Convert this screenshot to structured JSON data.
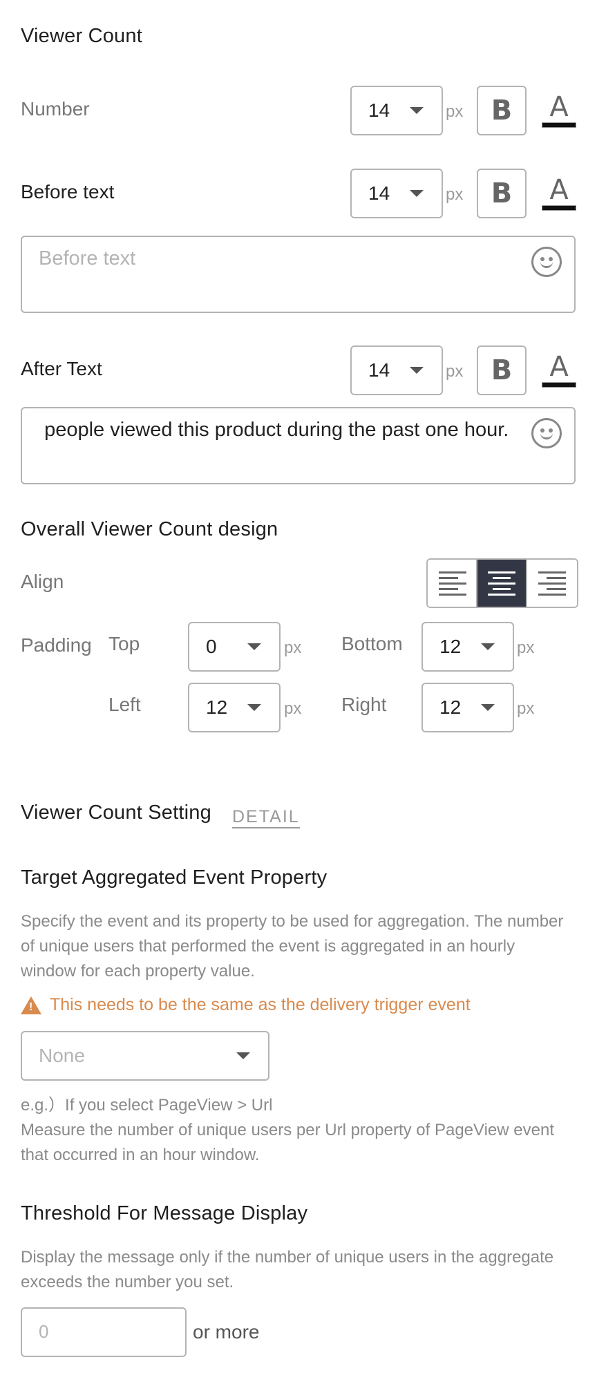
{
  "viewer_count": {
    "title": "Viewer Count",
    "number": {
      "label": "Number",
      "size": "14",
      "unit": "px",
      "bold": "B",
      "color": "A"
    },
    "before_text": {
      "label": "Before text",
      "size": "14",
      "unit": "px",
      "bold": "B",
      "color": "A",
      "placeholder": "Before text",
      "value": ""
    },
    "after_text": {
      "label": "After Text",
      "size": "14",
      "unit": "px",
      "bold": "B",
      "color": "A",
      "value": " people viewed this product during the past one hour."
    }
  },
  "overall_design": {
    "title": "Overall Viewer Count design",
    "align_label": "Align",
    "align_options": [
      "left",
      "center",
      "right"
    ],
    "align_selected": "center",
    "padding_label": "Padding",
    "padding": {
      "top_label": "Top",
      "top_value": "0",
      "bottom_label": "Bottom",
      "bottom_value": "12",
      "left_label": "Left",
      "left_value": "12",
      "right_label": "Right",
      "right_value": "12",
      "unit": "px"
    }
  },
  "setting": {
    "title": "Viewer Count Setting",
    "detail_link": "DETAIL",
    "target": {
      "title": "Target Aggregated Event Property",
      "description": "Specify the event and its property to be used for aggregation. The number of unique users that performed the event is aggregated in an hourly window for each property value.",
      "warning": "This needs to be the same as the delivery trigger event",
      "select_value": "None",
      "example_line1": "e.g.）If you select PageView > Url",
      "example_line2": "Measure the number of unique users per Url property of PageView event that occurred in an hour window."
    },
    "threshold": {
      "title": "Threshold For Message Display",
      "description": "Display the message only if the number of unique users in the aggregate exceeds the number you set.",
      "placeholder": "0",
      "suffix": "or more"
    }
  },
  "colors": {
    "accent_dark": "#333745",
    "warning": "#d98a4e",
    "border": "#b4b4b4"
  }
}
